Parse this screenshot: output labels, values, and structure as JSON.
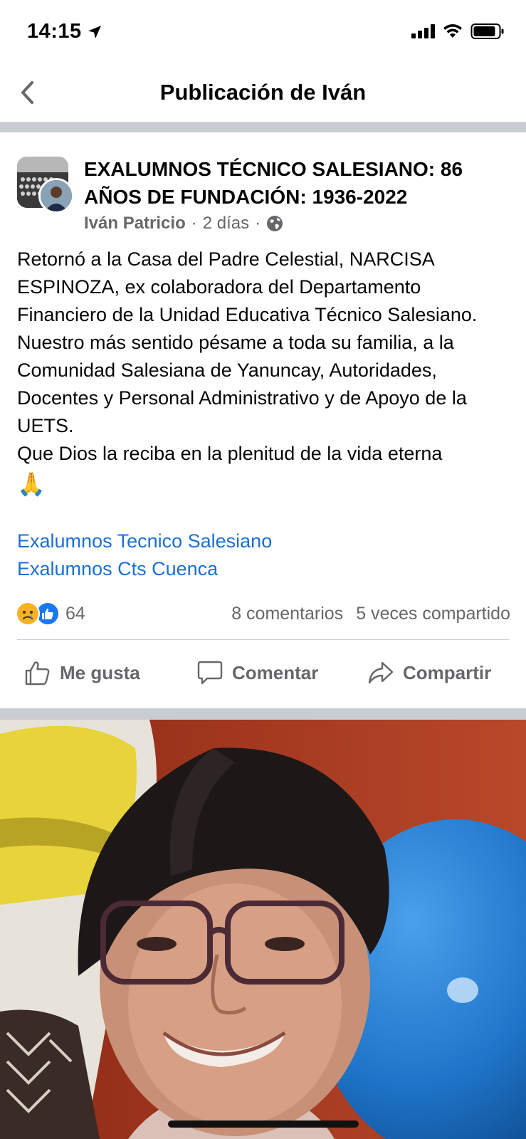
{
  "status_bar": {
    "time": "14:15"
  },
  "nav": {
    "title": "Publicación de Iván"
  },
  "post": {
    "group_title": "EXALUMNOS TÉCNICO SALESIANO: 86 AÑOS DE FUNDACIÓN: 1936-2022",
    "author": "Iván Patricio",
    "separator": "·",
    "time": "2 días",
    "body_paragraphs": [
      "Retornó a la Casa del Padre Celestial, NARCISA ESPINOZA, ex colaboradora del Departamento Financiero de la Unidad Educativa Técnico Salesiano.",
      "Nuestro más sentido pésame a toda su familia, a la Comunidad Salesiana de Yanuncay, Autoridades, Docentes y Personal Administrativo y de Apoyo de la UETS.",
      "Que Dios la reciba en la plenitud de la vida eterna"
    ],
    "emoji": "🙏",
    "hashtags": [
      "Exalumnos Tecnico Salesiano",
      "Exalumnos Cts Cuenca"
    ],
    "reaction_count": "64",
    "comments": "8 comentarios",
    "shares": "5 veces compartido"
  },
  "actions": {
    "like": "Me gusta",
    "comment": "Comentar",
    "share": "Compartir"
  },
  "colors": {
    "link": "#1b6fd6",
    "secondary_text": "#65676b",
    "like_blue": "#1877f2",
    "sad_yellow": "#f7b125"
  }
}
